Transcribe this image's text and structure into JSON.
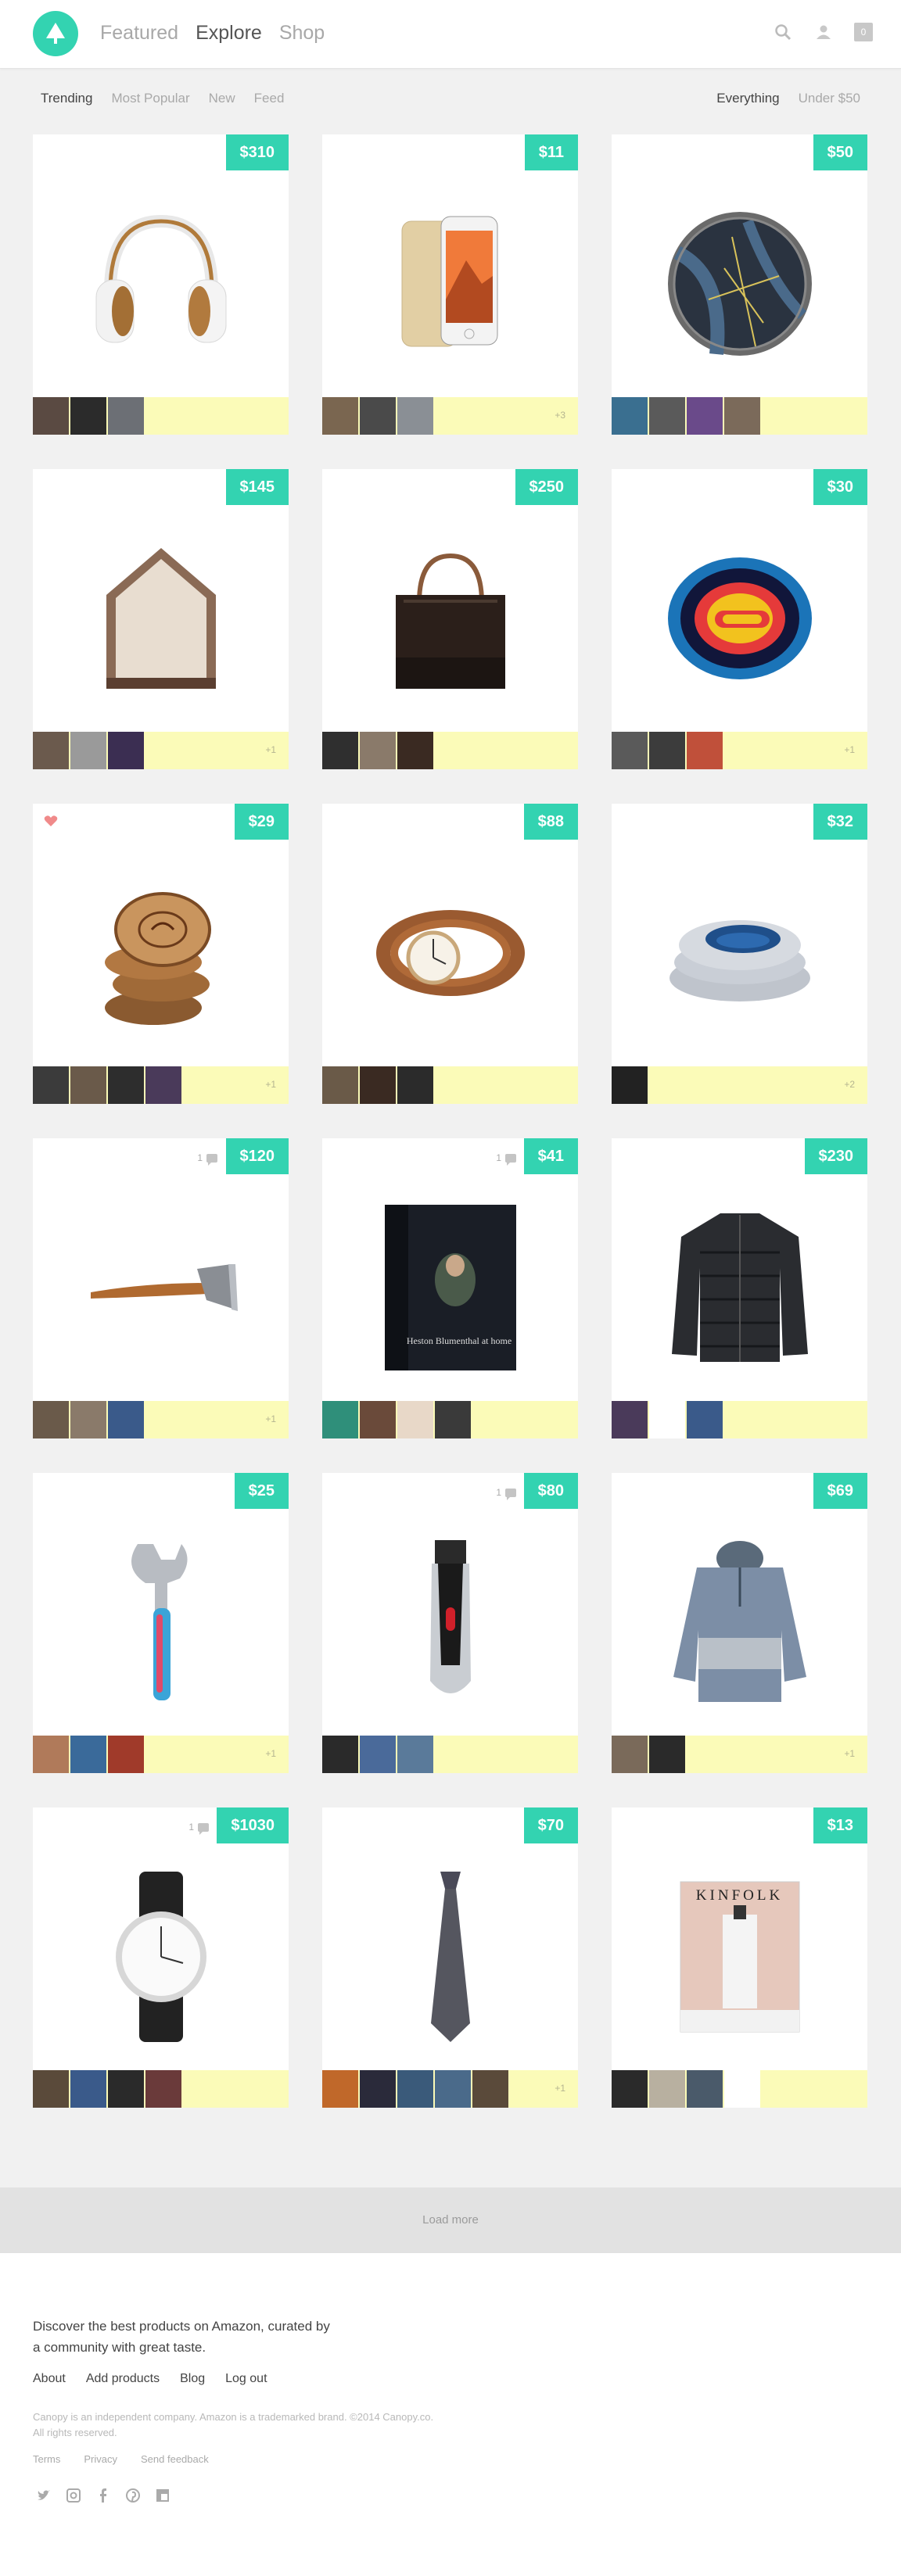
{
  "header": {
    "nav": [
      "Featured",
      "Explore",
      "Shop"
    ],
    "active_nav": "Explore",
    "icons": [
      "search-icon",
      "user-icon"
    ],
    "cart_count": "0"
  },
  "filters": {
    "left": [
      "Trending",
      "Most Popular",
      "New",
      "Feed"
    ],
    "right": [
      "Everything",
      "Under $50"
    ],
    "active_left": "Trending",
    "active_right": "Everything"
  },
  "colors": {
    "accent": "#33d3b1",
    "strip": "#fbfbb8",
    "heart": "#f08a8a"
  },
  "products": [
    {
      "name": "headphones",
      "price": "$310",
      "extra": "",
      "comments": "",
      "liked": false,
      "avatar_colors": [
        "#5a4a42",
        "#2b2b2b",
        "#6c6f75"
      ]
    },
    {
      "name": "phone-case",
      "price": "$11",
      "extra": "+3",
      "comments": "",
      "liked": false,
      "avatar_colors": [
        "#7a6650",
        "#4a4a4a",
        "#8a8f95"
      ]
    },
    {
      "name": "map-coaster",
      "price": "$50",
      "extra": "",
      "comments": "",
      "liked": false,
      "avatar_colors": [
        "#3a6f90",
        "#5a5a5a",
        "#6a4a8a",
        "#7b6a5a"
      ]
    },
    {
      "name": "house-shelf",
      "price": "$145",
      "extra": "+1",
      "comments": "",
      "liked": false,
      "avatar_colors": [
        "#6b5a4d",
        "#9a9a9a",
        "#3b2e52"
      ]
    },
    {
      "name": "tote-bag",
      "price": "$250",
      "extra": "",
      "comments": "",
      "liked": false,
      "avatar_colors": [
        "#2f2f2f",
        "#8a7a6a",
        "#3a2a22"
      ]
    },
    {
      "name": "colorado-coaster",
      "price": "$30",
      "extra": "+1",
      "comments": "",
      "liked": false,
      "avatar_colors": [
        "#5a5a5a",
        "#3c3c3c",
        "#c0503a"
      ]
    },
    {
      "name": "wood-coasters",
      "price": "$29",
      "extra": "+1",
      "comments": "",
      "liked": true,
      "avatar_colors": [
        "#3b3b3b",
        "#6a5a4a",
        "#2d2d2d",
        "#4a3a5a"
      ]
    },
    {
      "name": "leather-watch",
      "price": "$88",
      "extra": "",
      "comments": "",
      "liked": false,
      "avatar_colors": [
        "#6a5a48",
        "#3a2a22",
        "#2b2b2b"
      ]
    },
    {
      "name": "ostrich-pillow",
      "price": "$32",
      "extra": "+2",
      "comments": "",
      "liked": false,
      "avatar_colors": [
        "#222222"
      ]
    },
    {
      "name": "axe",
      "price": "$120",
      "extra": "+1",
      "comments": "1",
      "liked": false,
      "avatar_colors": [
        "#6a5a4a",
        "#8a7a6a",
        "#3a5a8a"
      ]
    },
    {
      "name": "cookbook",
      "price": "$41",
      "extra": "",
      "comments": "1",
      "liked": false,
      "avatar_colors": [
        "#2f8f7a",
        "#6a4a3a",
        "#e8d8c8",
        "#3a3a3a"
      ]
    },
    {
      "name": "down-jacket",
      "price": "$230",
      "extra": "",
      "comments": "",
      "liked": false,
      "avatar_colors": [
        "#4a3a5a",
        "#ffffff",
        "#3a5a8a"
      ]
    },
    {
      "name": "wrench",
      "price": "$25",
      "extra": "+1",
      "comments": "",
      "liked": false,
      "avatar_colors": [
        "#b07a5a",
        "#3a6a9a",
        "#a03a2a"
      ]
    },
    {
      "name": "beard-trimmer",
      "price": "$80",
      "extra": "",
      "comments": "1",
      "liked": false,
      "avatar_colors": [
        "#2a2a2a",
        "#4a6a9a",
        "#5a7a9a"
      ]
    },
    {
      "name": "pullover",
      "price": "$69",
      "extra": "+1",
      "comments": "",
      "liked": false,
      "avatar_colors": [
        "#7a6a5a",
        "#2a2a2a"
      ]
    },
    {
      "name": "wristwatch",
      "price": "$1030",
      "extra": "",
      "comments": "1",
      "liked": false,
      "avatar_colors": [
        "#5a4a3a",
        "#3a5a8a",
        "#2a2a2a",
        "#6a3a3a"
      ]
    },
    {
      "name": "necktie",
      "price": "$70",
      "extra": "+1",
      "comments": "",
      "liked": false,
      "avatar_colors": [
        "#c0682a",
        "#2a2a3a",
        "#3a5a7a",
        "#4a6a8a",
        "#5a4a3a"
      ]
    },
    {
      "name": "magazine",
      "price": "$13",
      "extra": "",
      "comments": "",
      "liked": false,
      "avatar_colors": [
        "#2a2a2a",
        "#b8b0a0",
        "#4a5a6a",
        "#ffffff"
      ]
    }
  ],
  "magazine_title": "KINFOLK",
  "cookbook_title": "Heston Blumenthal at home",
  "load_more": "Load more",
  "footer": {
    "tagline": "Discover the best products on Amazon, curated by a community with great taste.",
    "links": [
      "About",
      "Add products",
      "Blog",
      "Log out"
    ],
    "legal": "Canopy is an independent company. Amazon is a trademarked brand. ©2014 Canopy.co. All rights reserved.",
    "small_links": [
      "Terms",
      "Privacy",
      "Send feedback"
    ],
    "social": [
      "twitter-icon",
      "instagram-icon",
      "facebook-icon",
      "pinterest-icon",
      "flipboard-icon"
    ]
  }
}
